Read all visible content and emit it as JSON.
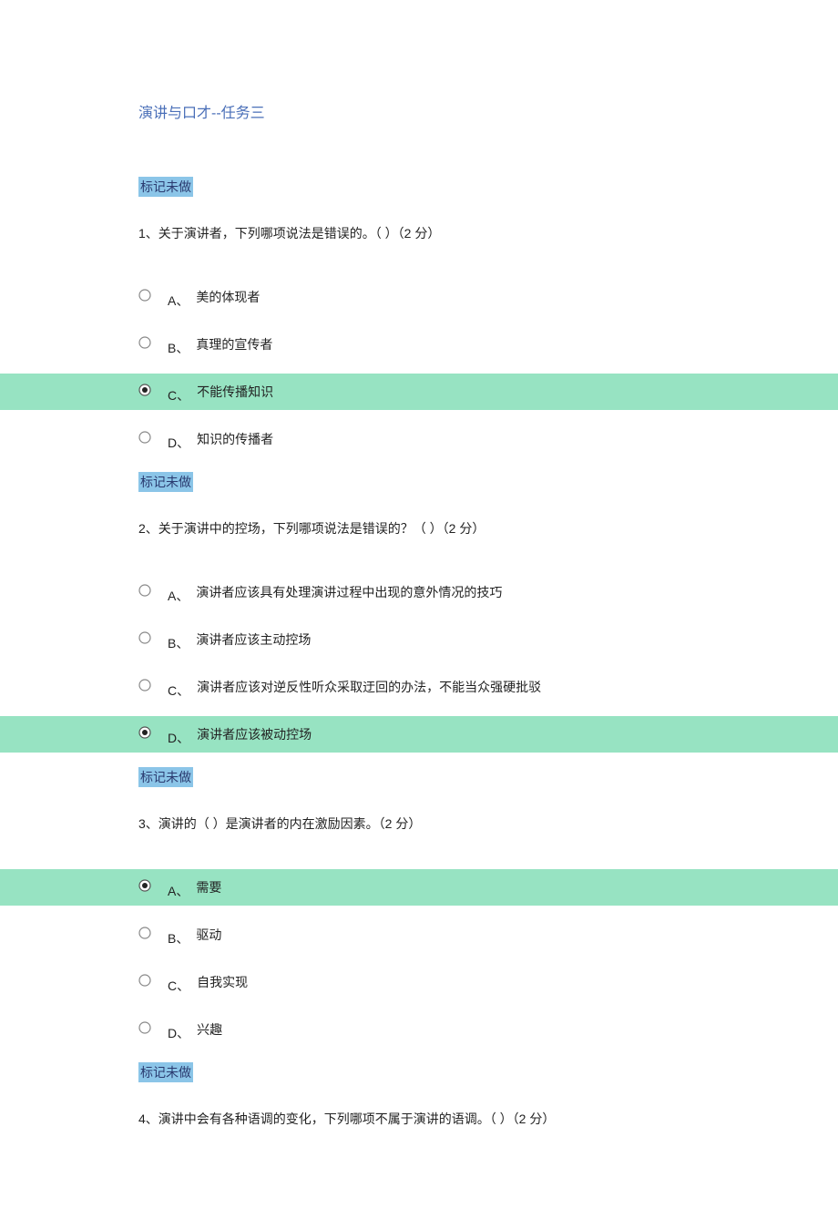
{
  "title": "演讲与口才--任务三",
  "markerLabel": "标记未做",
  "pointsSuffix": "（2 分）",
  "questions": [
    {
      "number": "1、",
      "stem": "关于演讲者，下列哪项说法是错误的。（ ）",
      "options": [
        {
          "letter": "A、",
          "text": "美的体现者",
          "selected": false
        },
        {
          "letter": "B、",
          "text": "真理的宣传者",
          "selected": false
        },
        {
          "letter": "C、",
          "text": "不能传播知识",
          "selected": true
        },
        {
          "letter": "D、",
          "text": "知识的传播者",
          "selected": false
        }
      ]
    },
    {
      "number": "2、",
      "stem": "关于演讲中的控场，下列哪项说法是错误的？（  ）",
      "options": [
        {
          "letter": "A、",
          "text": "演讲者应该具有处理演讲过程中出现的意外情况的技巧",
          "selected": false
        },
        {
          "letter": "B、",
          "text": "演讲者应该主动控场",
          "selected": false
        },
        {
          "letter": "C、",
          "text": "演讲者应该对逆反性听众采取迂回的办法，不能当众强硬批驳",
          "selected": false
        },
        {
          "letter": "D、",
          "text": "演讲者应该被动控场",
          "selected": true
        }
      ]
    },
    {
      "number": "3、",
      "stem": "演讲的（  ）是演讲者的内在激励因素。",
      "options": [
        {
          "letter": "A、",
          "text": "需要",
          "selected": true
        },
        {
          "letter": "B、",
          "text": "驱动",
          "selected": false
        },
        {
          "letter": "C、",
          "text": "自我实现",
          "selected": false
        },
        {
          "letter": "D、",
          "text": "兴趣",
          "selected": false
        }
      ]
    },
    {
      "number": "4、",
      "stem": "演讲中会有各种语调的变化，下列哪项不属于演讲的语调。（  ）",
      "options": []
    }
  ]
}
